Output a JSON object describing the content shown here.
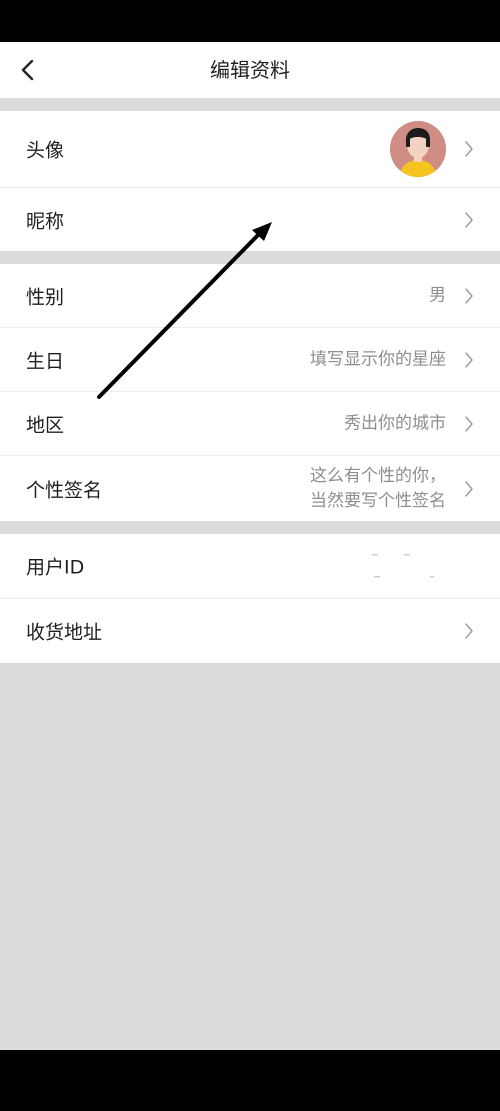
{
  "header": {
    "title": "编辑资料",
    "back_icon": "chevron-left-icon"
  },
  "profile": {
    "avatar_label": "头像",
    "nickname_label": "昵称",
    "nickname_value": ""
  },
  "details": {
    "gender_label": "性别",
    "gender_value": "男",
    "birthday_label": "生日",
    "birthday_placeholder": "填写显示你的星座",
    "region_label": "地区",
    "region_placeholder": "秀出你的城市",
    "signature_label": "个性签名",
    "signature_placeholder_line1": "这么有个性的你，",
    "signature_placeholder_line2": "当然要写个性签名"
  },
  "account": {
    "user_id_label": "用户ID",
    "address_label": "收货地址"
  },
  "annotation": {
    "arrow_color": "#000000"
  },
  "colors": {
    "background": "#dcdcdc",
    "row_background": "#ffffff",
    "label_text": "#1f1f1f",
    "value_text": "#8e8e8e",
    "avatar_background": "#cf8d85",
    "avatar_shirt": "#f5c31d"
  }
}
